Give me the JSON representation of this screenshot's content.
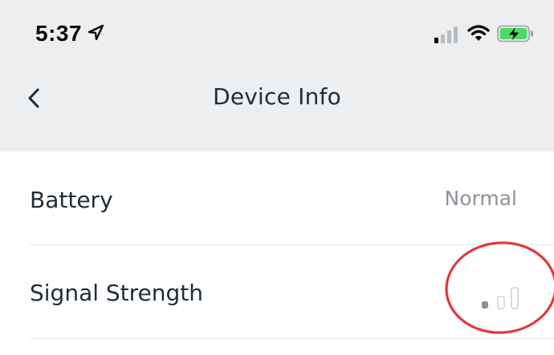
{
  "status_bar": {
    "time": "5:37",
    "icons": [
      "location-arrow-icon",
      "cellular-signal-icon",
      "wifi-icon",
      "battery-charging-icon"
    ]
  },
  "nav": {
    "back_icon": "chevron-left-icon",
    "title": "Device Info"
  },
  "rows": [
    {
      "label": "Battery",
      "value": "Normal"
    },
    {
      "label": "Signal Strength",
      "signal_level": 1,
      "signal_max": 3
    }
  ],
  "colors": {
    "header_bg": "#eceef0",
    "text_primary": "#1f2d3a",
    "text_secondary": "#8d9399",
    "battery_fill": "#4cd964",
    "annotation": "#e0393e"
  }
}
